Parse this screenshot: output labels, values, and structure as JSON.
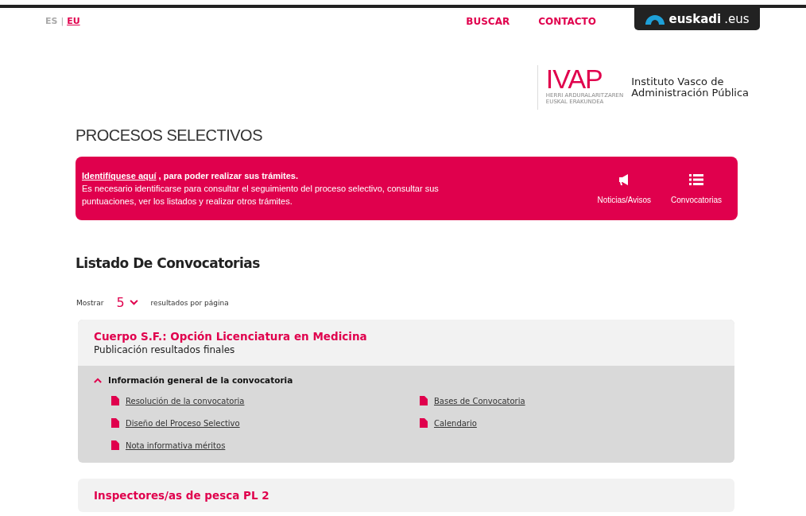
{
  "languages": [
    {
      "label": "ES",
      "selected": false
    },
    {
      "label": "EU",
      "selected": true
    }
  ],
  "language_separator": "|",
  "nav": [
    "BUSCAR",
    "CONTACTO"
  ],
  "portal_badge": {
    "bold": "euskadi",
    "light": ".eus"
  },
  "logo": {
    "acronym": "IVAP",
    "subtitle_lines": [
      "HERRI ARDURALARITZAREN",
      "EUSKAL ERAKUNDEA"
    ],
    "name_lines": [
      "Instituto Vasco de",
      "Administración Pública"
    ]
  },
  "page_title": "PROCESOS SELECTIVOS",
  "banner": {
    "link": "Identifíquese aquí",
    "lead": " , para poder realizar sus trámites.",
    "text": "Es necesario identificarse para consultar el seguimiento del proceso selectivo, consultar sus puntuaciones, ver los listados y realizar otros trámites.",
    "actions": [
      {
        "kind": "megaphone",
        "label": "Noticias/Avisos"
      },
      {
        "kind": "list",
        "label": "Convocatorias"
      }
    ]
  },
  "list_heading": "Listado De Convocatorias",
  "page_size": {
    "before": "Mostrar",
    "value": "5",
    "after": "resultados por página"
  },
  "cards": [
    {
      "title": "Cuerpo S.F.: Opción Licenciatura en Medicina",
      "subtitle": "Publicación resultados finales",
      "section": {
        "title": "Información general de la convocatoria",
        "expanded": true,
        "documents": [
          "Resolución de la convocatoria",
          "Bases de Convocatoria",
          "Diseño del Proceso Selectivo",
          "Calendario",
          "Nota informativa méritos"
        ]
      }
    },
    {
      "title": "Inspectores/as de pesca PL 2"
    }
  ]
}
